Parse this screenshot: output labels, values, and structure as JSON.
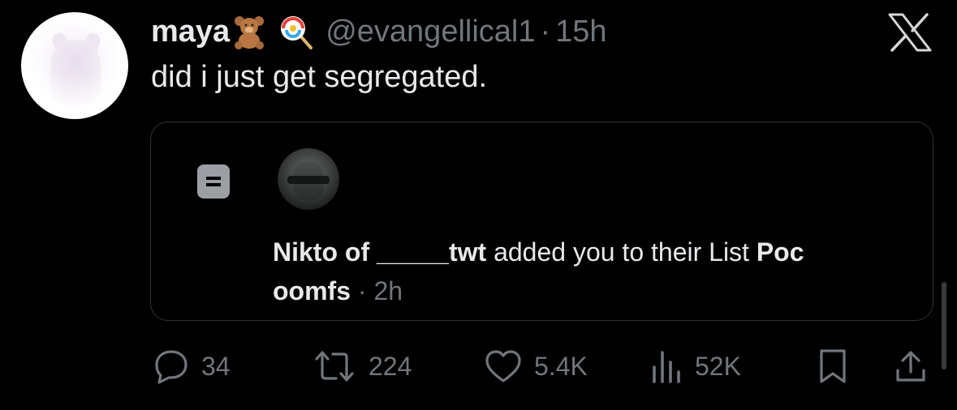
{
  "tweet": {
    "author_name": "maya",
    "author_emojis": [
      "teddy-bear",
      "lollipop"
    ],
    "handle": "@evangellical1",
    "separator": "·",
    "time": "15h",
    "text": "did i just get segregated."
  },
  "quoted_notification": {
    "actor": "Nikto of _____twt",
    "action_text": " added you to their List ",
    "list_name_part1": "Poc",
    "list_name_part2": "oomfs",
    "separator": "·",
    "time": "2h"
  },
  "actions": {
    "replies": "34",
    "retweets": "224",
    "likes": "5.4K",
    "views": "52K"
  },
  "colors": {
    "background": "#000000",
    "text": "#e7e9ea",
    "secondary": "#71767b",
    "border": "#2f3336"
  },
  "icons": [
    "x-logo-icon",
    "list-icon",
    "reply-icon",
    "retweet-icon",
    "like-icon",
    "views-icon",
    "bookmark-icon",
    "share-icon"
  ]
}
